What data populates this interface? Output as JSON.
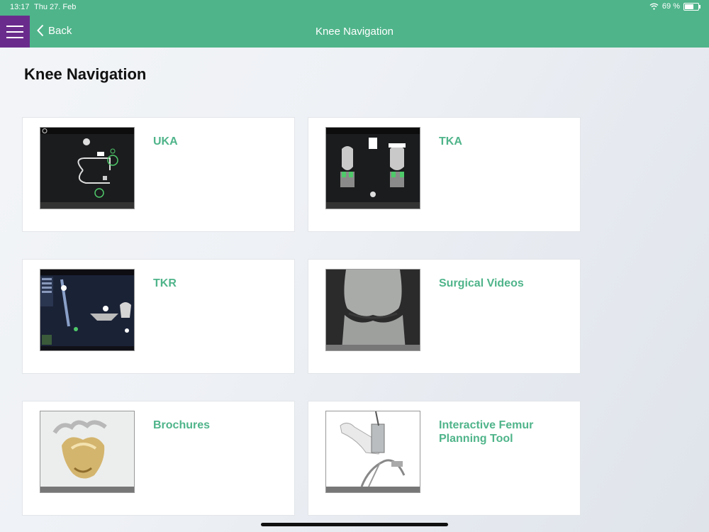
{
  "status": {
    "time": "13:17",
    "date": "Thu 27. Feb",
    "battery": "69 %"
  },
  "nav": {
    "back_label": "Back",
    "title": "Knee Navigation"
  },
  "page": {
    "heading": "Knee Navigation"
  },
  "cards": [
    {
      "label": "UKA"
    },
    {
      "label": "TKA"
    },
    {
      "label": "TKR"
    },
    {
      "label": "Surgical Videos"
    },
    {
      "label": "Brochures"
    },
    {
      "label": "Interactive Femur Planning Tool"
    }
  ],
  "colors": {
    "accent": "#4fb48a",
    "menu": "#6a2c8c"
  }
}
